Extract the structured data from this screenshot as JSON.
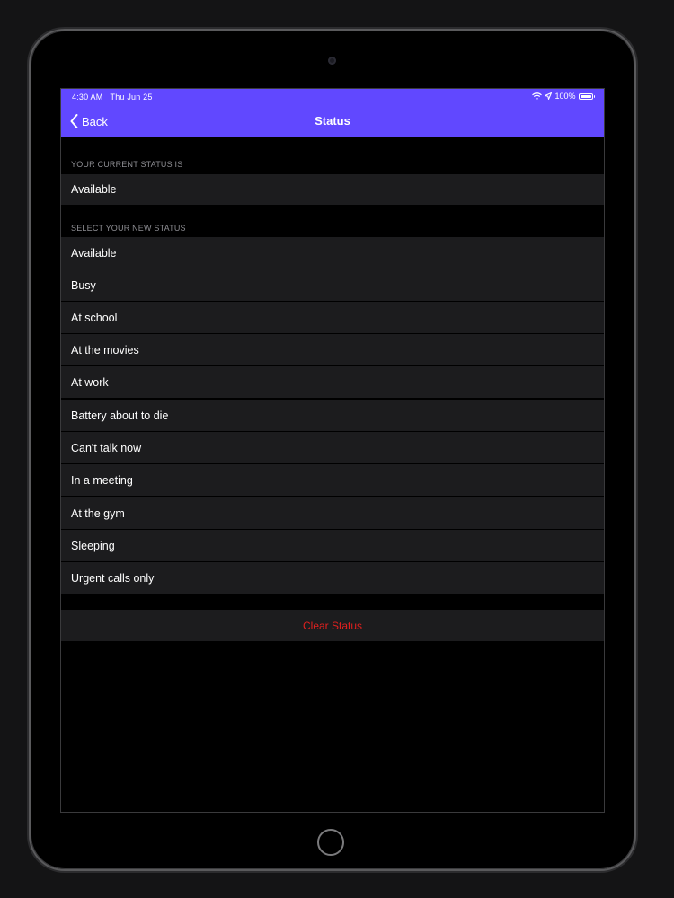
{
  "status_bar": {
    "time": "4:30 AM",
    "date": "Thu Jun 25",
    "battery": "100%",
    "battery_level": 1.0,
    "wifi_icon": "wifi-icon",
    "location_icon": "location-arrow-icon"
  },
  "navbar": {
    "back_label": "Back",
    "back_icon": "chevron-left-icon",
    "title": "Status",
    "background": "#6148ff"
  },
  "current_section": {
    "header": "YOUR CURRENT STATUS IS",
    "value": "Available"
  },
  "new_section": {
    "header": "SELECT YOUR NEW STATUS",
    "options": [
      "Available",
      "Busy",
      "At school",
      "At the movies",
      "At work",
      "Battery about to die",
      "Can't talk now",
      "In a meeting",
      "At the gym",
      "Sleeping",
      "Urgent calls only"
    ]
  },
  "clear_button": {
    "label": "Clear Status",
    "color": "#e0201f"
  }
}
